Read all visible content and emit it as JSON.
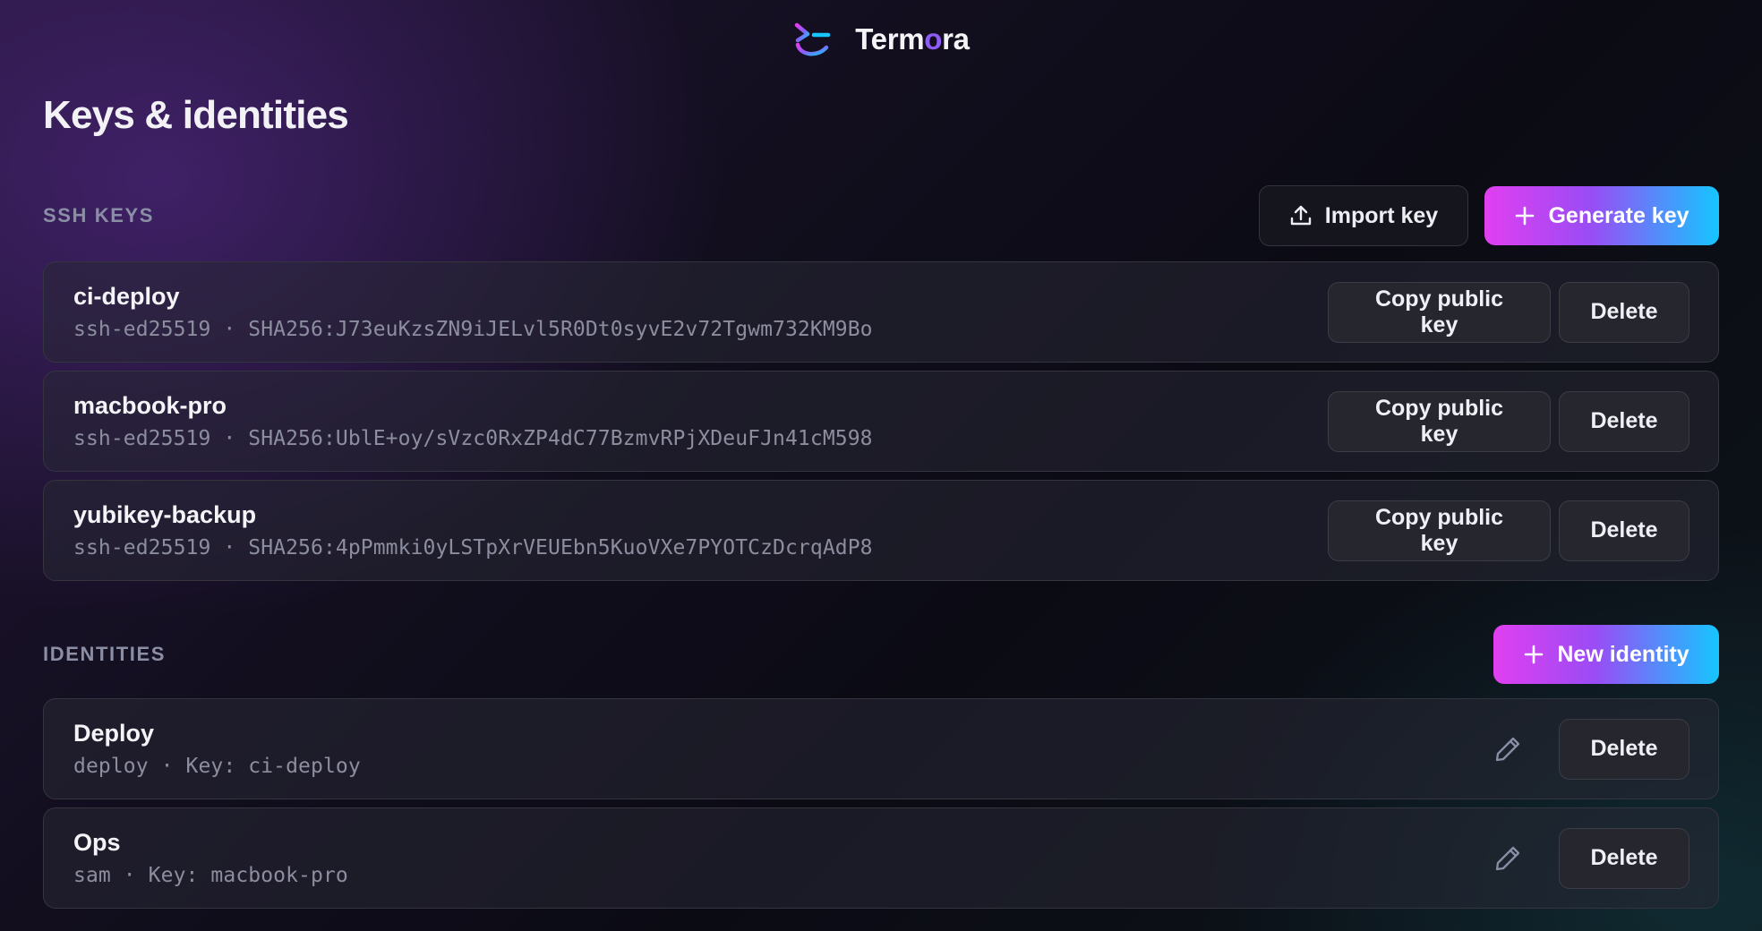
{
  "app": {
    "brand_prefix": "Term",
    "brand_o": "o",
    "brand_suffix": "ra"
  },
  "page": {
    "title": "Keys & identities"
  },
  "colors": {
    "gradient_start": "#e13ff0",
    "gradient_end": "#15c6ff",
    "accent": "#8d5cf6"
  },
  "ssh_keys": {
    "label": "SSH KEYS",
    "import_label": "Import key",
    "generate_label": "Generate key",
    "items": [
      {
        "name": "ci-deploy",
        "detail": "ssh-ed25519 · SHA256:J73euKzsZN9iJELvl5R0Dt0syvE2v72Tgwm732KM9Bo",
        "copy_label": "Copy public key",
        "delete_label": "Delete"
      },
      {
        "name": "macbook-pro",
        "detail": "ssh-ed25519 · SHA256:UblE+oy/sVzc0RxZP4dC77BzmvRPjXDeuFJn41cM598",
        "copy_label": "Copy public key",
        "delete_label": "Delete"
      },
      {
        "name": "yubikey-backup",
        "detail": "ssh-ed25519 · SHA256:4pPmmki0yLSTpXrVEUEbn5KuoVXe7PYOTCzDcrqAdP8",
        "copy_label": "Copy public key",
        "delete_label": "Delete"
      }
    ]
  },
  "identities": {
    "label": "IDENTITIES",
    "new_label": "New identity",
    "items": [
      {
        "name": "Deploy",
        "detail": "deploy · Key: ci-deploy",
        "delete_label": "Delete"
      },
      {
        "name": "Ops",
        "detail": "sam · Key: macbook-pro",
        "delete_label": "Delete"
      }
    ]
  },
  "icons": {
    "logo": "termora-logo-icon",
    "import": "upload-icon",
    "generate": "plus-icon",
    "new_identity": "plus-icon",
    "edit": "pencil-icon"
  }
}
